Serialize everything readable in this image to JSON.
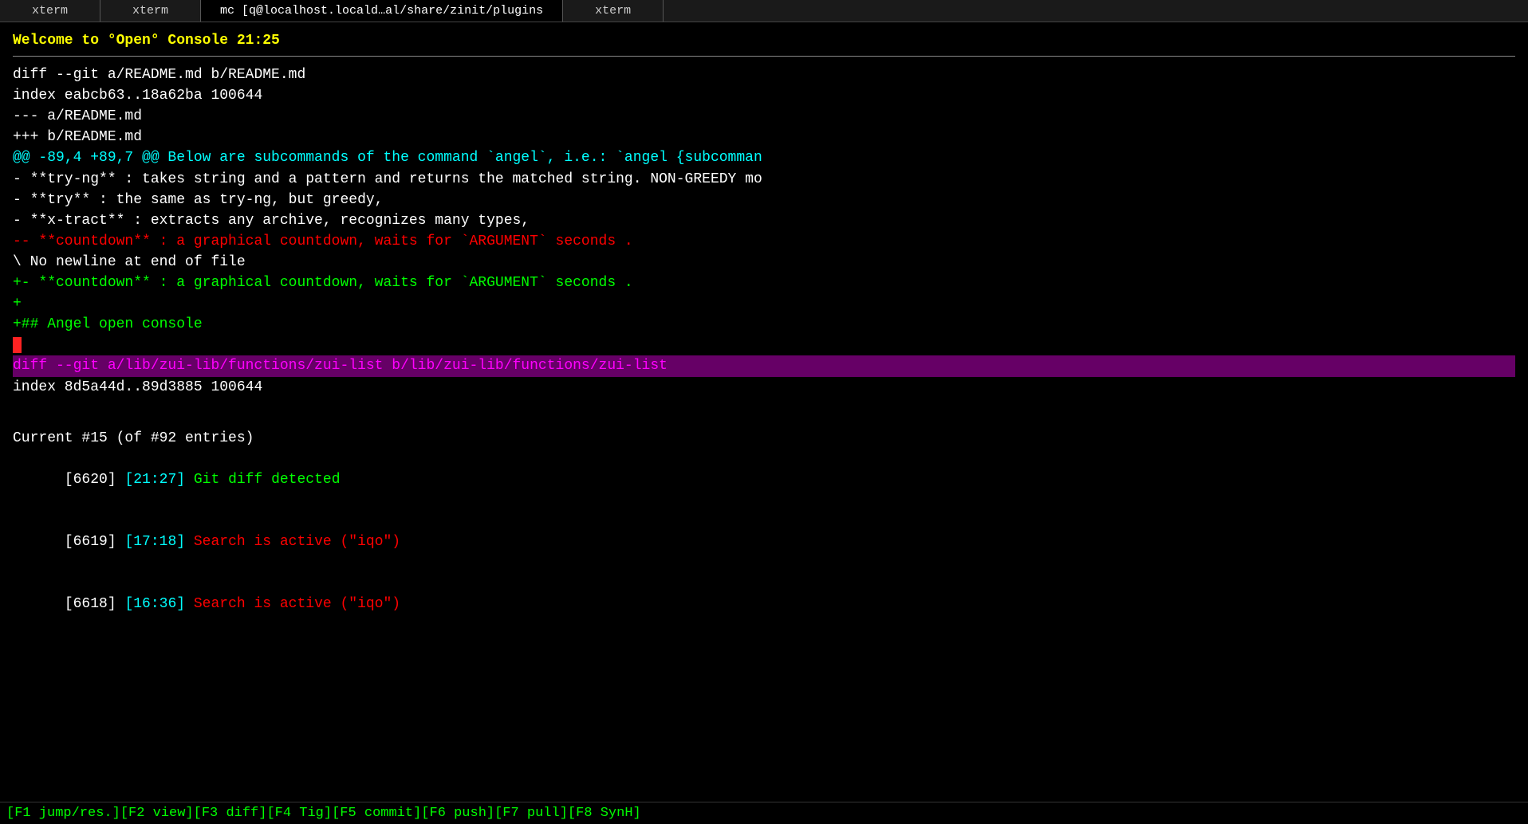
{
  "tabs": [
    {
      "label": "xterm",
      "active": false
    },
    {
      "label": "xterm",
      "active": false
    },
    {
      "label": "mc [q@localhost.locald…al/share/zinit/plugins",
      "active": true
    },
    {
      "label": "xterm",
      "active": false
    }
  ],
  "welcome": "Welcome to °Open° Console 21:25",
  "diff_lines": [
    {
      "text": "diff --git a/README.md b/README.md",
      "color": "white"
    },
    {
      "text": "index eabcb63..18a62ba 100644",
      "color": "white"
    },
    {
      "text": "--- a/README.md",
      "color": "white"
    },
    {
      "text": "+++ b/README.md",
      "color": "white"
    },
    {
      "text": "@@ -89,4 +89,7 @@ Below are subcommands of the command `angel`, i.e.: `angel {subcomman",
      "color": "cyan"
    },
    {
      "text": "- **try-ng** : takes string and a pattern and returns the matched string. NON-GREEDY mo",
      "color": "white"
    },
    {
      "text": "- **try** : the same as try-ng, but greedy,",
      "color": "white"
    },
    {
      "text": "- **x-tract** : extracts any archive, recognizes many types,",
      "color": "white"
    },
    {
      "text": "-- **countdown** : a graphical countdown, waits for `ARGUMENT` seconds .",
      "color": "red"
    },
    {
      "text": "\\ No newline at end of file",
      "color": "white"
    },
    {
      "text": "+- **countdown** : a graphical countdown, waits for `ARGUMENT` seconds .",
      "color": "green"
    },
    {
      "text": "+",
      "color": "green"
    },
    {
      "text": "+## Angel open console",
      "color": "green"
    },
    {
      "text": "+",
      "color": "green",
      "cursor": true
    }
  ],
  "diff2_line": "diff --git a/lib/zui-lib/functions/zui-list b/lib/zui-lib/functions/zui-list",
  "index2_line": "index 8d5a44d..89d3885 100644",
  "log": {
    "current": "Current #15 (of #92 entries)",
    "entries": [
      {
        "id": "[6620]",
        "time": "[21:27]",
        "msg": "Git diff detected",
        "color_time": "cyan",
        "color_msg": "green"
      },
      {
        "id": "[6619]",
        "time": "[17:18]",
        "msg": "Search is active (\"iqo\")",
        "color_time": "cyan",
        "color_msg": "red"
      },
      {
        "id": "[6618]",
        "time": "[16:36]",
        "msg": "Search is active (\"iqo\")",
        "color_time": "cyan",
        "color_msg": "red"
      }
    ]
  },
  "bottom_bar": "[F1 jump/res.][F2 view][F3 diff][F4 Tig][F5 commit][F6 push][F7 pull][F8 SynH]"
}
